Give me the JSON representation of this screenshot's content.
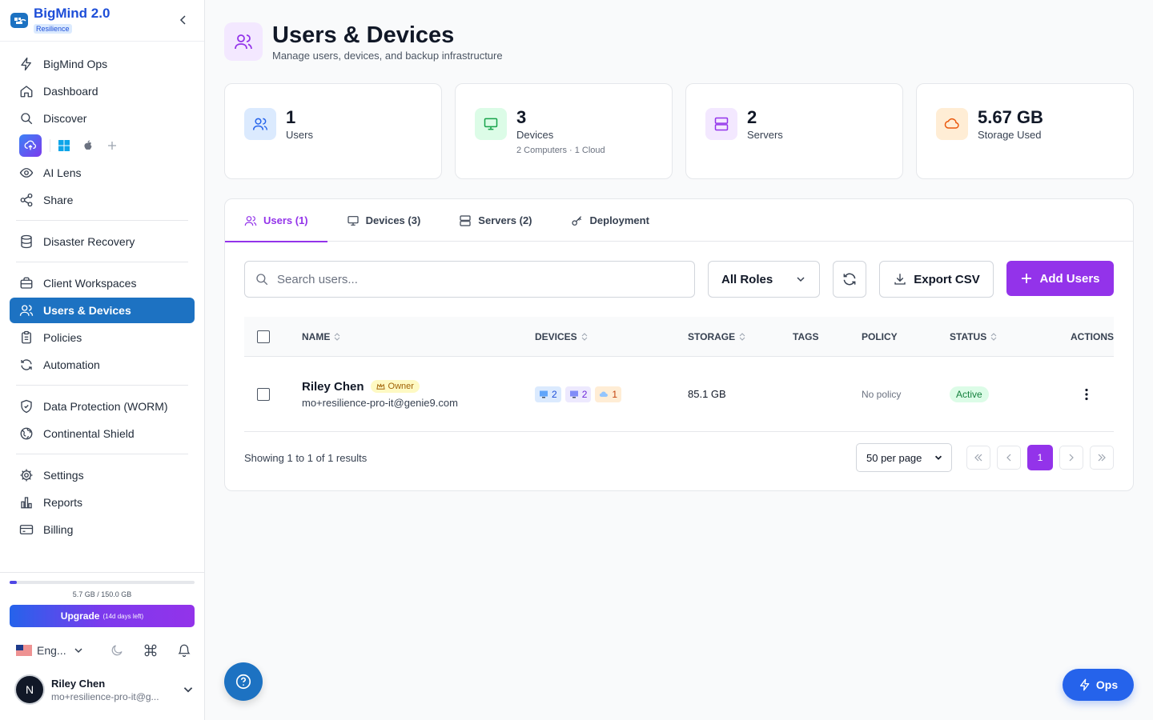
{
  "app": {
    "name": "BigMind 2.0",
    "badge": "Resilience"
  },
  "sidebar": {
    "items": [
      {
        "label": "BigMind Ops",
        "icon": "lightning-icon"
      },
      {
        "label": "Dashboard",
        "icon": "home-icon"
      },
      {
        "label": "Discover",
        "icon": "search-icon"
      },
      {
        "label": "AI Lens",
        "icon": "eye-icon"
      },
      {
        "label": "Share",
        "icon": "share-icon"
      },
      {
        "label": "Disaster Recovery",
        "icon": "database-icon"
      },
      {
        "label": "Client Workspaces",
        "icon": "briefcase-icon"
      },
      {
        "label": "Users & Devices",
        "icon": "users-icon",
        "active": true
      },
      {
        "label": "Policies",
        "icon": "clipboard-icon"
      },
      {
        "label": "Automation",
        "icon": "refresh-icon"
      },
      {
        "label": "Data Protection (WORM)",
        "icon": "shield-icon"
      },
      {
        "label": "Continental Shield",
        "icon": "globe-icon"
      },
      {
        "label": "Settings",
        "icon": "gear-icon"
      },
      {
        "label": "Reports",
        "icon": "bar-chart-icon"
      },
      {
        "label": "Billing",
        "icon": "credit-card-icon"
      }
    ],
    "storage": {
      "text": "5.7 GB / 150.0 GB",
      "fraction": 0.038
    },
    "upgrade": {
      "label": "Upgrade",
      "note": "(14d days left)"
    },
    "language": "Eng...",
    "user": {
      "initial": "N",
      "name": "Riley Chen",
      "email": "mo+resilience-pro-it@g..."
    }
  },
  "header": {
    "title": "Users & Devices",
    "subtitle": "Manage users, devices, and backup infrastructure"
  },
  "stats": [
    {
      "value": "1",
      "label": "Users",
      "sub": "",
      "color": "#dbeafe"
    },
    {
      "value": "3",
      "label": "Devices",
      "sub": "2 Computers · 1 Cloud",
      "color": "#dcfce7"
    },
    {
      "value": "2",
      "label": "Servers",
      "sub": "",
      "color": "#f3e8ff"
    },
    {
      "value": "5.67 GB",
      "label": "Storage Used",
      "sub": "",
      "color": "#ffedd5"
    }
  ],
  "tabs": [
    {
      "label": "Users (1)",
      "active": true
    },
    {
      "label": "Devices (3)"
    },
    {
      "label": "Servers (2)"
    },
    {
      "label": "Deployment"
    }
  ],
  "toolbar": {
    "search_placeholder": "Search users...",
    "roles_label": "All Roles",
    "export_label": "Export CSV",
    "add_label": "Add Users"
  },
  "table": {
    "columns": [
      "NAME",
      "DEVICES",
      "STORAGE",
      "TAGS",
      "POLICY",
      "STATUS",
      "ACTIONS"
    ],
    "rows": [
      {
        "name": "Riley Chen",
        "role_badge": "Owner",
        "email": "mo+resilience-pro-it@genie9.com",
        "devices": [
          {
            "icon": "computer-icon",
            "count": "2"
          },
          {
            "icon": "server-icon",
            "count": "2"
          },
          {
            "icon": "cloud-icon",
            "count": "1"
          }
        ],
        "storage": "85.1 GB",
        "tags": "",
        "policy": "No policy",
        "status": "Active"
      }
    ]
  },
  "pagination": {
    "showing": "Showing 1 to 1 of 1 results",
    "per_page": "50 per page",
    "current_page": "1"
  },
  "fab": {
    "ops_label": "Ops"
  },
  "colors": {
    "accent": "#9333ea",
    "sidebar_active": "#1d72c2",
    "brand": "#1d4ed8"
  }
}
